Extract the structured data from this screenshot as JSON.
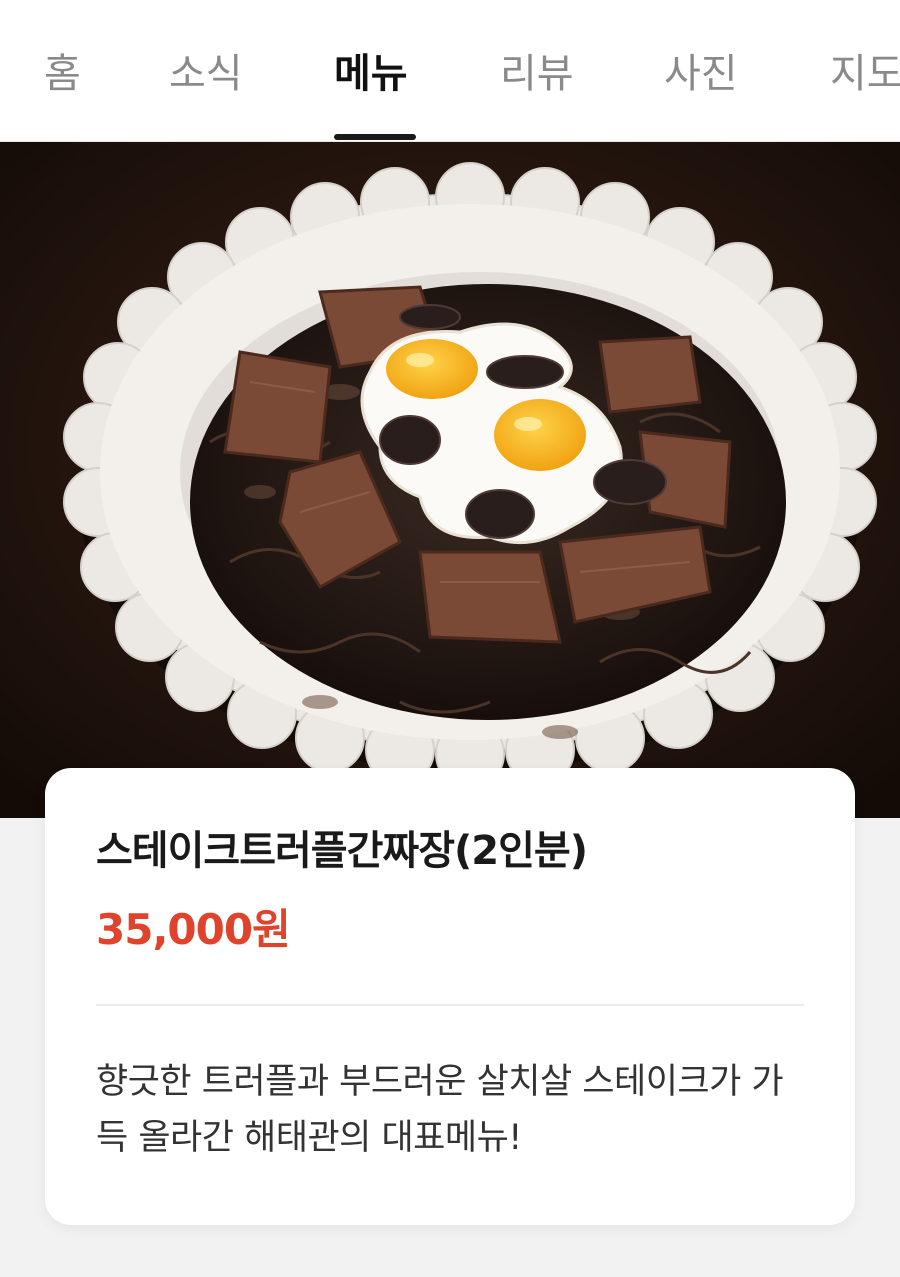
{
  "tabs": [
    {
      "label": "홈",
      "active": false
    },
    {
      "label": "소식",
      "active": false
    },
    {
      "label": "메뉴",
      "active": true
    },
    {
      "label": "리뷰",
      "active": false
    },
    {
      "label": "사진",
      "active": false
    },
    {
      "label": "지도",
      "active": false
    }
  ],
  "menu_item": {
    "name": "스테이크트러플간짜장(2인분)",
    "price": "35,000원",
    "description": "향긋한 트러플과 부드러운 살치살 스테이크가 가득 올라간 해태관의 대표메뉴!"
  },
  "colors": {
    "price": "#e0432b",
    "active_tab": "#111111",
    "inactive_tab": "#8a8a8a"
  }
}
